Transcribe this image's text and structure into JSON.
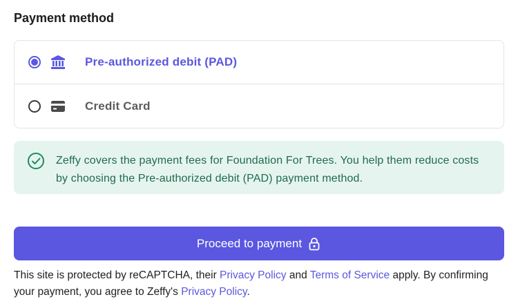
{
  "section": {
    "title": "Payment method"
  },
  "payment_options": [
    {
      "label": "Pre-authorized debit (PAD)",
      "icon": "bank-icon",
      "selected": true
    },
    {
      "label": "Credit Card",
      "icon": "credit-card-icon",
      "selected": false
    }
  ],
  "notice": {
    "icon": "check-circle-icon",
    "text": "Zeffy covers the payment fees for Foundation For Trees. You help them reduce costs by choosing the Pre-authorized debit (PAD) payment method."
  },
  "proceed_button": {
    "label": "Proceed to payment",
    "icon": "lock-icon"
  },
  "legal": {
    "part1": "This site is protected by reCAPTCHA, their ",
    "privacy_link_1": "Privacy Policy",
    "part2": " and ",
    "terms_link": "Terms of Service",
    "part3": " apply. By confirming your payment, you agree to Zeffy's ",
    "privacy_link_2": "Privacy Policy",
    "part4": "."
  },
  "colors": {
    "accent": "#5b57e0",
    "notice_bg": "#e6f4f0",
    "notice_text": "#1f6b4a"
  }
}
